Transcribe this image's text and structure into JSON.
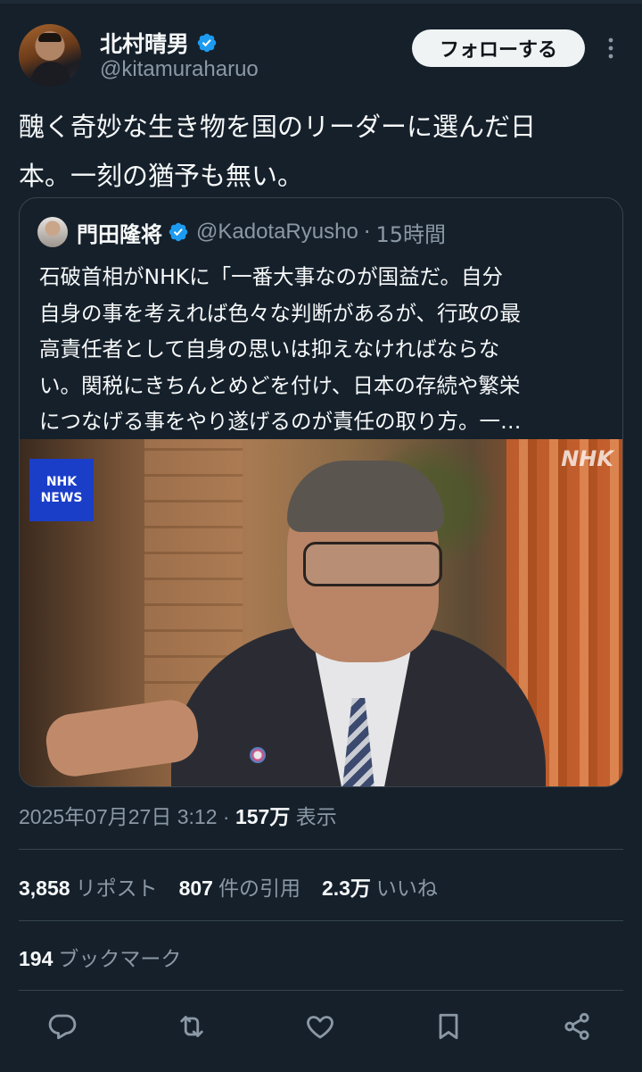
{
  "author": {
    "name": "北村晴男",
    "handle": "@kitamuraharuo",
    "verified_icon": "verified-badge-icon"
  },
  "follow_button": {
    "label": "フォローする"
  },
  "tweet": {
    "line1": "醜く奇妙な生き物を国のリーダーに選んだ日",
    "line2": "本。一刻の猶予も無い。"
  },
  "quote": {
    "name": "門田隆将",
    "handle": "@KadotaRyusho",
    "separator": "·",
    "time": "15時間",
    "lines": [
      "石破首相がNHKに「一番大事なのが国益だ。自分",
      "自身の事を考えれば色々な判断があるが、行政の最",
      "高責任者として自身の思いは抑えなければならな",
      "い。関税にきちんとめどを付け、日本の存続や繁栄",
      "につなげる事をやり遂げるのが責任の取り方。一…"
    ],
    "image": {
      "nhk_logo_top": "NHK",
      "nhk_logo_bottom": "NEWS",
      "corner_mark": "NHK"
    }
  },
  "meta": {
    "datetime": "2025年07月27日 3:12",
    "separator": "·",
    "views_count": "157万",
    "views_label": "表示"
  },
  "stats": {
    "reposts_count": "3,858",
    "reposts_label": "リポスト",
    "quotes_count": "807",
    "quotes_label": "件の引用",
    "likes_count": "2.3万",
    "likes_label": "いいね",
    "bookmarks_count": "194",
    "bookmarks_label": "ブックマーク"
  },
  "colors": {
    "background": "#15202b",
    "accent": "#1d9bf0",
    "muted_text": "#8b98a5",
    "border": "#38444d"
  },
  "action_icons": [
    "reply-icon",
    "repost-icon",
    "like-icon",
    "bookmark-icon",
    "share-icon"
  ]
}
